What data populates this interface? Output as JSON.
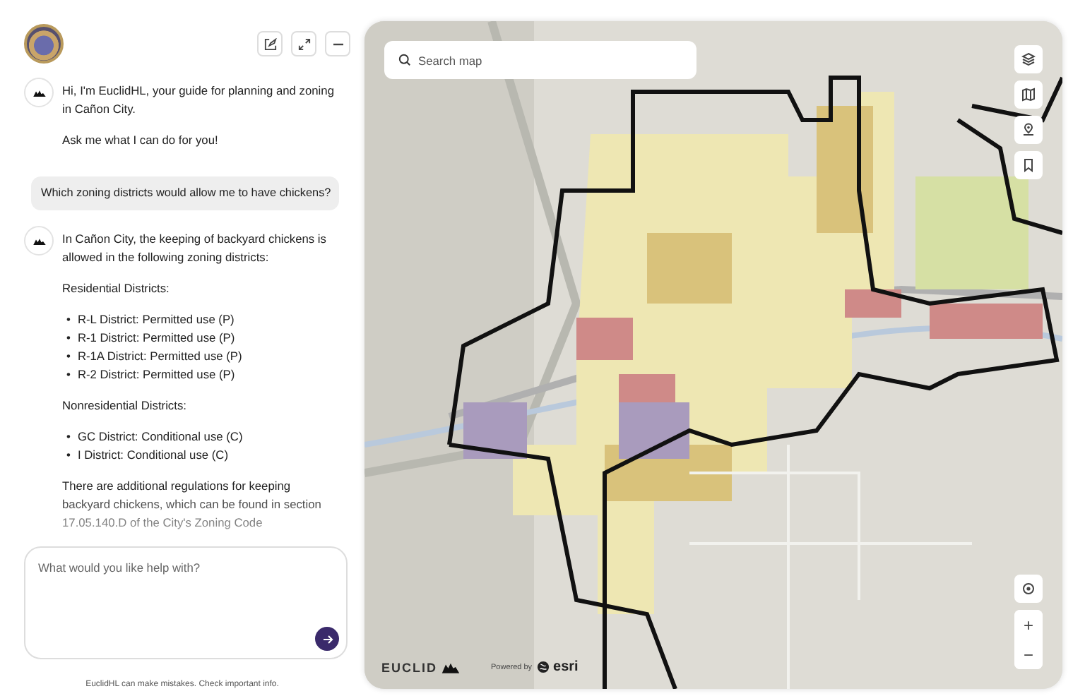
{
  "chat": {
    "messages": [
      {
        "kind": "assistant",
        "blocks": [
          {
            "kind": "paragraph",
            "text": "Hi, I'm EuclidHL, your guide for planning and zoning in Cañon City."
          },
          {
            "kind": "paragraph",
            "text": "Ask me what I can do for you!"
          }
        ]
      },
      {
        "kind": "user",
        "text": "Which zoning districts would allow me to have chickens?"
      },
      {
        "kind": "assistant",
        "blocks": [
          {
            "kind": "paragraph",
            "text": "In Cañon City, the keeping of backyard chickens is allowed in the following zoning districts:"
          },
          {
            "kind": "paragraph",
            "text": "Residential Districts:"
          },
          {
            "kind": "list",
            "marker": "•",
            "items": [
              "R-L District: Permitted use (P)",
              "R-1 District: Permitted use (P)",
              "R-1A District: Permitted use (P)",
              "R-2 District: Permitted use (P)"
            ]
          },
          {
            "kind": "paragraph",
            "text": "Nonresidential Districts:"
          },
          {
            "kind": "list",
            "marker": "•",
            "items": [
              "GC District: Conditional use (C)",
              "I District: Conditional use (C)"
            ]
          },
          {
            "kind": "paragraph",
            "text": "There are additional regulations for keeping backyard chickens, which can be found in section 17.05.140.D of the City's Zoning Code"
          }
        ]
      }
    ],
    "composer": {
      "placeholder": "What would you like help with?"
    },
    "disclaimer": "EuclidHL can make mistakes. Check important info."
  },
  "map": {
    "search": {
      "placeholder": "Search map"
    },
    "brand": {
      "logo_text": "EUCLID",
      "powered_by": "Powered by",
      "provider": "esri"
    },
    "zoom": {
      "in": "+",
      "out": "−"
    }
  }
}
